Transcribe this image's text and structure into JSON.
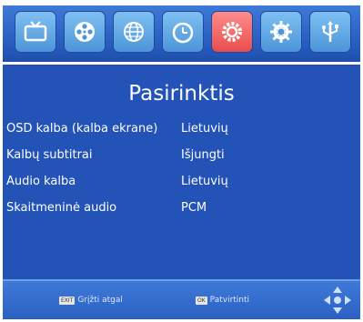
{
  "icons": [
    "tv-icon",
    "film-reel-icon",
    "globe-grid-icon",
    "clock-icon",
    "settings-gear-icon",
    "tools-icon",
    "usb-icon"
  ],
  "selected_icon": "settings-gear-icon",
  "colors": {
    "background": "#2453b8",
    "bar": "#3f7ad8",
    "tile": "#6fb2ee",
    "tile_selected": "#f06a6a",
    "text": "#ffffff"
  },
  "menu": {
    "title": "Pasirinktis",
    "rows": [
      {
        "label": "OSD kalba (kalba ekrane)",
        "value": "Lietuvių"
      },
      {
        "label": "Kalbų subtitrai",
        "value": "Išjungti"
      },
      {
        "label": "Audio kalba",
        "value": "Lietuvių"
      },
      {
        "label": "Skaitmeninė audio",
        "value": "PCM"
      }
    ]
  },
  "footer": {
    "exit_key": "EXIT",
    "exit_label": "Grįžti atgal",
    "ok_key": "OK",
    "ok_label": "Patvirtinti"
  }
}
